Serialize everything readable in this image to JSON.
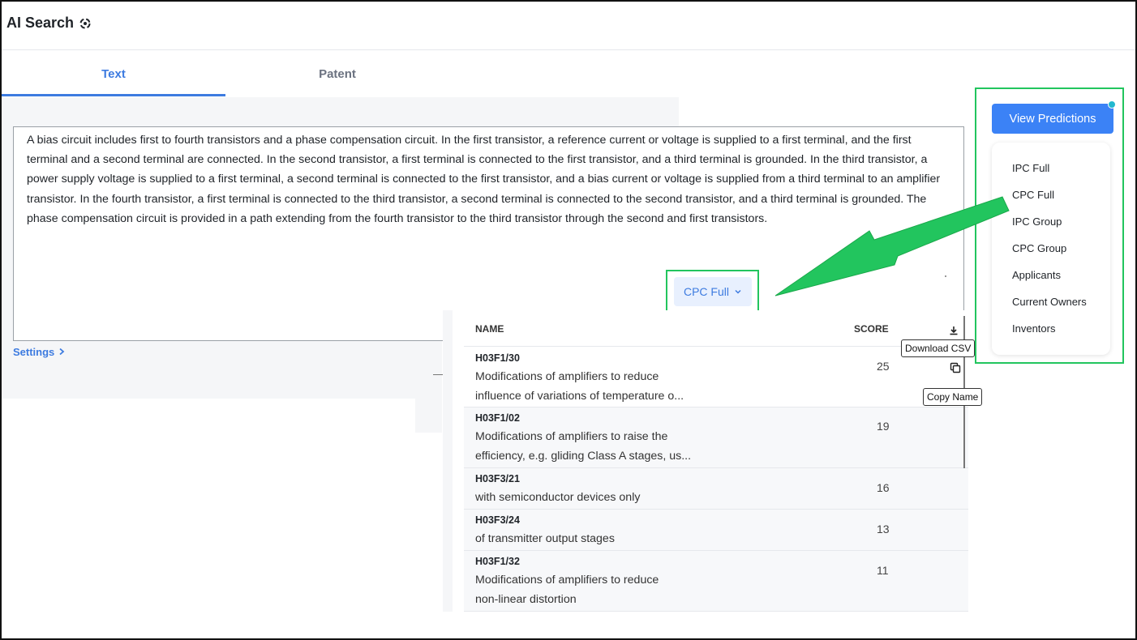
{
  "app": {
    "title": "AI Search",
    "title_icon": "refresh-sparkle-icon"
  },
  "tabs": [
    {
      "label": "Text",
      "active": true
    },
    {
      "label": "Patent",
      "active": false
    }
  ],
  "query": {
    "text": "A bias circuit includes first to fourth transistors and a phase compensation circuit. In the first transistor, a reference current or voltage is supplied to a first terminal, and the first terminal and a second terminal are connected. In the second transistor, a first terminal is connected to the first transistor, and a third terminal is grounded. In the third transistor, a power supply voltage is supplied to a first terminal, a second terminal is connected to the first transistor, and a bias current or voltage is supplied from a third terminal to an amplifier transistor. In the fourth transistor, a first terminal is connected to the third transistor, a second terminal is connected to the second transistor, and a third terminal is grounded. The phase compensation circuit is provided in a path extending from the fourth transistor to the third transistor through the second and first transistors."
  },
  "settings": {
    "label": "Settings",
    "icon": "chevron-right-icon"
  },
  "classification_select": {
    "selected": "CPC Full",
    "icon": "chevron-down-icon"
  },
  "results": {
    "columns": {
      "name": "NAME",
      "score": "SCORE"
    },
    "download_icon": "download-icon",
    "copy_icon": "copy-icon",
    "rows": [
      {
        "code": "H03F1/30",
        "desc_line1": "Modifications of amplifiers to reduce",
        "desc_line2": "influence of variations of temperature o...",
        "score": "25"
      },
      {
        "code": "H03F1/02",
        "desc_line1": "Modifications of amplifiers to raise the",
        "desc_line2": "efficiency, e.g. gliding Class A stages, us...",
        "score": "19"
      },
      {
        "code": "H03F3/21",
        "desc_line1": "with semiconductor devices only",
        "desc_line2": "",
        "score": "16"
      },
      {
        "code": "H03F3/24",
        "desc_line1": "of transmitter output stages",
        "desc_line2": "",
        "score": "13"
      },
      {
        "code": "H03F1/32",
        "desc_line1": "Modifications of amplifiers to reduce",
        "desc_line2": "non-linear distortion",
        "score": "11"
      }
    ]
  },
  "tooltips": {
    "download": "Download CSV",
    "copy": "Copy Name"
  },
  "predictions": {
    "button_label": "View Predictions",
    "items": [
      "IPC Full",
      "CPC Full",
      "IPC Group",
      "CPC Group",
      "Applicants",
      "Current Owners",
      "Inventors"
    ]
  },
  "colors": {
    "accent": "#3d7be0",
    "button": "#3b82f6",
    "highlight": "#22c55e",
    "notification": "#22b8cf"
  }
}
